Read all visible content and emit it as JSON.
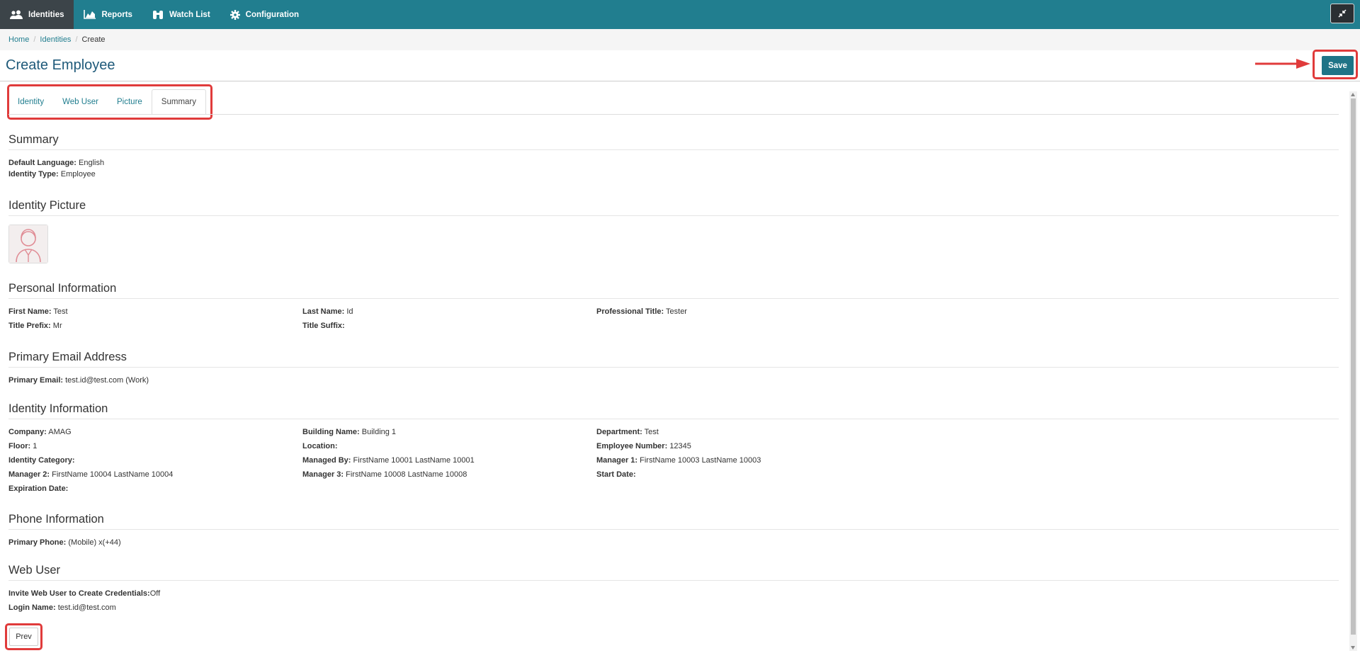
{
  "nav": {
    "items": [
      {
        "label": "Identities",
        "icon": "users-icon",
        "active": true
      },
      {
        "label": "Reports",
        "icon": "area-chart-icon",
        "active": false
      },
      {
        "label": "Watch List",
        "icon": "binoculars-icon",
        "active": false
      },
      {
        "label": "Configuration",
        "icon": "gear-icon",
        "active": false
      }
    ],
    "collapse_icon": "compress-icon"
  },
  "breadcrumb": {
    "home": "Home",
    "identities": "Identities",
    "current": "Create"
  },
  "page": {
    "title": "Create Employee",
    "save_label": "Save",
    "prev_label": "Prev"
  },
  "tabs": [
    "Identity",
    "Web User",
    "Picture",
    "Summary"
  ],
  "active_tab": "Summary",
  "summary": {
    "heading": "Summary",
    "default_language_label": "Default Language:",
    "default_language": "English",
    "identity_type_label": "Identity Type:",
    "identity_type": "Employee"
  },
  "picture": {
    "heading": "Identity Picture"
  },
  "personal": {
    "heading": "Personal Information",
    "first_name_label": "First Name:",
    "first_name": "Test",
    "last_name_label": "Last Name:",
    "last_name": "Id",
    "professional_title_label": "Professional Title:",
    "professional_title": "Tester",
    "title_prefix_label": "Title Prefix:",
    "title_prefix": "Mr",
    "title_suffix_label": "Title Suffix:",
    "title_suffix": ""
  },
  "email": {
    "heading": "Primary Email Address",
    "primary_label": "Primary Email:",
    "primary": "test.id@test.com (Work)"
  },
  "identity": {
    "heading": "Identity Information",
    "company_label": "Company:",
    "company": "AMAG",
    "building_label": "Building Name:",
    "building": "Building 1",
    "department_label": "Department:",
    "department": "Test",
    "floor_label": "Floor:",
    "floor": "1",
    "location_label": "Location:",
    "location": "",
    "employee_number_label": "Employee Number:",
    "employee_number": "12345",
    "category_label": "Identity Category:",
    "category": "",
    "managed_by_label": "Managed By:",
    "managed_by": "FirstName 10001 LastName 10001",
    "manager1_label": "Manager 1:",
    "manager1": "FirstName 10003 LastName 10003",
    "manager2_label": "Manager 2:",
    "manager2": "FirstName 10004 LastName 10004",
    "manager3_label": "Manager 3:",
    "manager3": "FirstName 10008 LastName 10008",
    "start_date_label": "Start Date:",
    "start_date": "",
    "expiration_label": "Expiration Date:",
    "expiration": ""
  },
  "phone": {
    "heading": "Phone Information",
    "primary_label": "Primary Phone:",
    "primary": "(Mobile) x(+44)"
  },
  "webuser": {
    "heading": "Web User",
    "invite_label": "Invite Web User to Create Credentials:",
    "invite": "Off",
    "login_label": "Login Name:",
    "login": "test.id@test.com"
  },
  "colors": {
    "nav": "#217e8f",
    "nav_active": "#3c4449",
    "save": "#1f7487",
    "highlight": "#e03b3b",
    "title": "#1f5a7a"
  }
}
